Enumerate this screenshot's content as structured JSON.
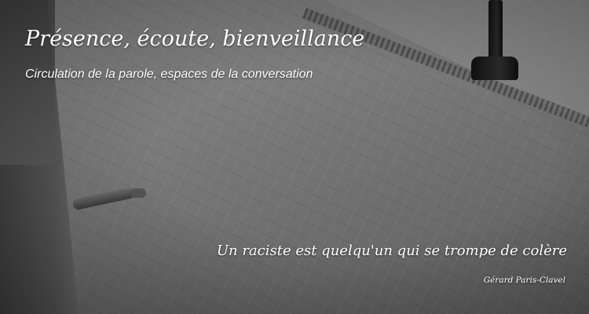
{
  "header": {
    "title": "Présence, écoute, bienveillance",
    "subtitle": "Circulation de la parole, espaces de la conversation"
  },
  "quote": {
    "text": "Un raciste est quelqu'un qui se trompe de colère",
    "author": "Gérard Paris-Clavel"
  },
  "colors": {
    "text": "#ffffff",
    "background": "#7a7a7a"
  }
}
